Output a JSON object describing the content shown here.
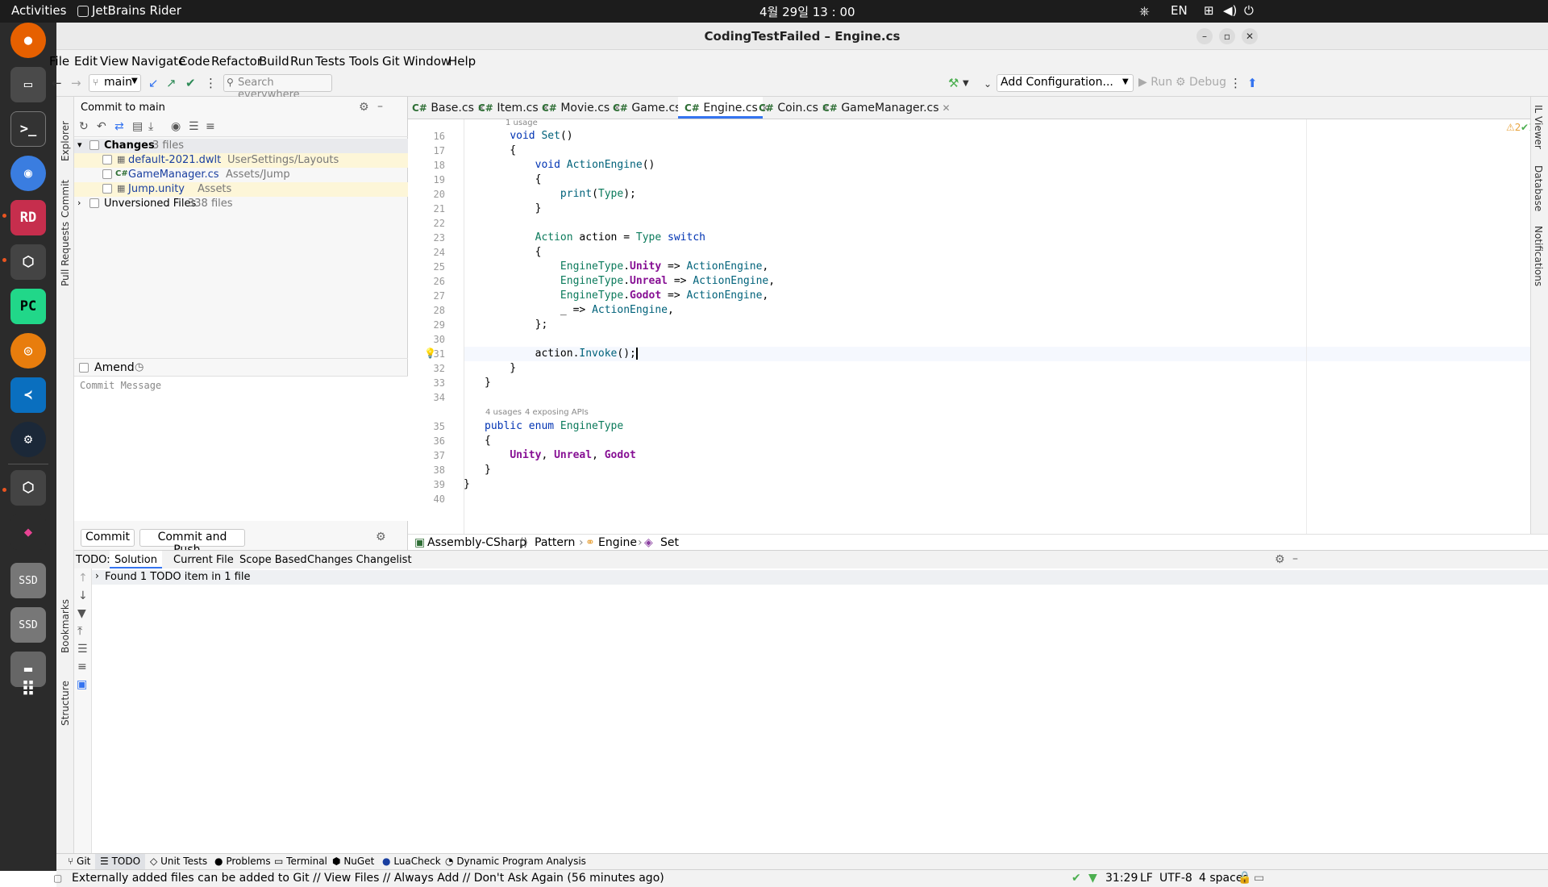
{
  "topbar": {
    "activities": "Activities",
    "app": "JetBrains Rider",
    "clock": "4월 29일  13 : 00",
    "lang": "EN"
  },
  "dock": {
    "items": [
      "firefox-icon",
      "files-icon",
      "terminal-icon",
      "chrome-icon",
      "rider-icon",
      "unity-icon",
      "pycharm-icon",
      "blender-icon",
      "vscode-icon",
      "steam-icon",
      "unity-hub-icon",
      "krita-icon",
      "ssd-drive-icon",
      "ssd-drive-icon",
      "trash-icon",
      "apps-grid-icon"
    ],
    "ssd": "SSD"
  },
  "window": {
    "title": "CodingTestFailed – Engine.cs"
  },
  "menu": [
    "File",
    "Edit",
    "View",
    "Navigate",
    "Code",
    "Refactor",
    "Build",
    "Run",
    "Tests",
    "Tools",
    "Git",
    "Window",
    "Help"
  ],
  "toolbar": {
    "branch": "main",
    "search_placeholder": "Search everywhere",
    "config": "Add Configuration...",
    "run": "Run",
    "debug": "Debug"
  },
  "left_strip": {
    "explorer": "Explorer",
    "commit": "Commit",
    "pull_requests": "Pull Requests",
    "bookmarks": "Bookmarks",
    "structure": "Structure"
  },
  "right_strip": {
    "il_viewer": "IL Viewer",
    "database": "Database",
    "notifications": "Notifications"
  },
  "commit_panel": {
    "title": "Commit to main",
    "changes_label": "Changes",
    "changes_count": "3 files",
    "files": [
      {
        "name": "default-2021.dwlt",
        "path": "UserSettings/Layouts",
        "kind": "file"
      },
      {
        "name": "GameManager.cs",
        "path": "Assets/Jump",
        "kind": "cs"
      },
      {
        "name": "Jump.unity",
        "path": "Assets",
        "kind": "file"
      }
    ],
    "unversioned_label": "Unversioned Files",
    "unversioned_count": "338 files",
    "amend": "Amend",
    "message_placeholder": "Commit Message",
    "commit_btn": "Commit",
    "commit_push_btn": "Commit and Push..."
  },
  "tabs": [
    {
      "name": "Base.cs",
      "active": false
    },
    {
      "name": "Item.cs",
      "active": false
    },
    {
      "name": "Movie.cs",
      "active": false
    },
    {
      "name": "Game.cs",
      "active": false
    },
    {
      "name": "Engine.cs",
      "active": true
    },
    {
      "name": "Coin.cs",
      "active": false
    },
    {
      "name": "GameManager.cs",
      "active": false
    }
  ],
  "tab_prefix": "C#",
  "editor": {
    "hint_usage": "1 usage",
    "hint_usages": "4 usages",
    "hint_apis": "4 exposing APIs",
    "warnings": "2",
    "oks": "1",
    "line_numbers": [
      "16",
      "17",
      "18",
      "19",
      "20",
      "21",
      "22",
      "23",
      "24",
      "25",
      "26",
      "27",
      "28",
      "29",
      "30",
      "31",
      "32",
      "33",
      "34",
      "35",
      "36",
      "37",
      "38",
      "39",
      "40"
    ]
  },
  "breadcrumb": {
    "assembly": "Assembly-CSharp",
    "ns": "Pattern",
    "cls": "Engine",
    "method": "Set"
  },
  "todo": {
    "label": "TODO:",
    "tabs": [
      "Solution",
      "Current File",
      "Scope Based",
      "Changes Changelist"
    ],
    "result": "Found 1 TODO item in 1 file"
  },
  "toolwindows": [
    "Git",
    "TODO",
    "Unit Tests",
    "Problems",
    "Terminal",
    "NuGet",
    "LuaCheck",
    "Dynamic Program Analysis"
  ],
  "status": {
    "message": "Externally added files can be added to Git // View Files // Always Add // Don't Ask Again (56 minutes ago)",
    "position": "31:29",
    "line_sep": "LF",
    "encoding": "UTF-8",
    "indent": "4 spaces"
  },
  "colors": {
    "accent": "#3574f0",
    "dock_bg": "#2b2b2b",
    "topbar_bg": "#1c1c1c",
    "modified_file": "#fdf6d8",
    "warning": "#e8a33d",
    "ok": "#4caf50"
  }
}
